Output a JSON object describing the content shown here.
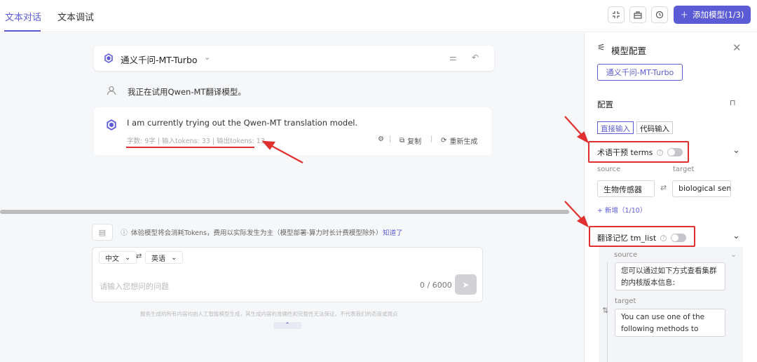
{
  "header": {
    "tabs": [
      {
        "label": "文本对话",
        "active": true
      },
      {
        "label": "文本调试",
        "active": false
      }
    ],
    "icons": [
      "collapse-icon",
      "toolbox-icon",
      "history-icon"
    ],
    "add_model_label": "添加模型(1/3)",
    "accent_color": "#5b5bd6"
  },
  "chat": {
    "model_name": "通义千问-MT-Turbo",
    "user_message": "我正在试用Qwen-MT翻译模型。",
    "reply": {
      "text": "I am currently trying out the Qwen-MT translation model.",
      "stats": "字数: 9字 | 输入tokens: 33 | 输出tokens: 13",
      "copy_label": "复制",
      "regenerate_label": "重新生成"
    }
  },
  "composer": {
    "notice": "体验模型将会消耗Tokens，费用以实际发生为主（模型部署-算力时长计费模型除外）",
    "notice_link": "知道了",
    "source_lang": "中文",
    "target_lang": "英语",
    "placeholder": "请输入您想问的问题",
    "counter": "0 / 6000",
    "disclaimer": "服务生成的所有内容均由人工智能模型生成，其生成内容的准确性和完整性无法保证，不代表我们的态度或观点"
  },
  "sidebar": {
    "title": "模型配置",
    "model_pill": "通义千问-MT-Turbo",
    "config_label": "配置",
    "input_modes": [
      "直接输入",
      "代码输入"
    ],
    "terms": {
      "title": "术语干预 terms",
      "enabled": false,
      "source_label": "source",
      "target_label": "target",
      "source_value": "生物传感器",
      "target_value": "biological sensor",
      "add_label": "+ 新增（1/10）"
    },
    "tm_list": {
      "title": "翻译记忆 tm_list",
      "enabled": false,
      "source_label": "source",
      "source_value": "您可以通过如下方式查看集群的内核版本信息:",
      "target_label": "target",
      "target_value": "You can use one of the following methods to query"
    }
  }
}
